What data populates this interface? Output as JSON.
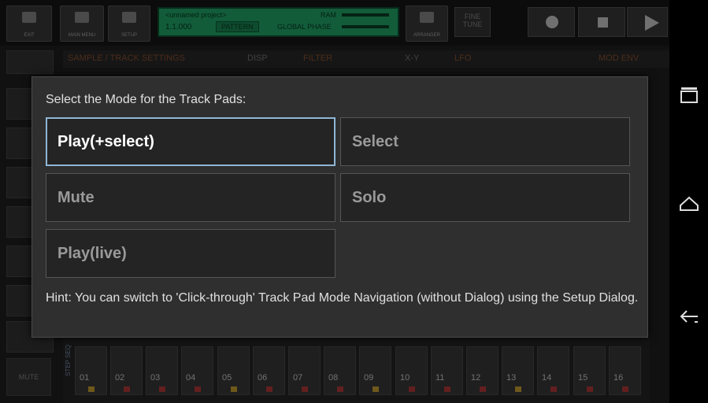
{
  "toolbar": {
    "exit_label": "EXIT",
    "main_menu_label": "MAIN MENU",
    "setup_label": "SETUP",
    "arranger_label": "ARRANGER",
    "fine_tune_label": "FINE TUNE",
    "lcd": {
      "project": "<unnamed project>",
      "position": "1.1.000",
      "pattern": "PATTERN",
      "ram": "RAM",
      "global_phase": "GLOBAL PHASE"
    }
  },
  "background_tabs": {
    "sample_track": "SAMPLE / TRACK SETTINGS",
    "disp": "DISP",
    "filter": "FILTER",
    "xy": "X-Y",
    "lfo": "LFO",
    "mod_env": "MOD ENV"
  },
  "dialog": {
    "title": "Select the Mode for the Track Pads:",
    "options": [
      {
        "label": "Play(+select)",
        "selected": true
      },
      {
        "label": "Select",
        "selected": false
      },
      {
        "label": "Mute",
        "selected": false
      },
      {
        "label": "Solo",
        "selected": false
      },
      {
        "label": "Play(live)",
        "selected": false
      }
    ],
    "hint": "Hint: You can switch to 'Click-through' Track Pad Mode Navigation (without Dialog) using the Setup Dialog."
  },
  "step_seq": {
    "label": "STEP SEQ",
    "steps": [
      "01",
      "02",
      "03",
      "04",
      "05",
      "06",
      "07",
      "08",
      "09",
      "10",
      "11",
      "12",
      "13",
      "14",
      "15",
      "16"
    ]
  },
  "side": {
    "mute_label": "MUTE"
  },
  "colors": {
    "accent_selected": "#8fb7d6",
    "lcd_green": "#22a86a"
  }
}
